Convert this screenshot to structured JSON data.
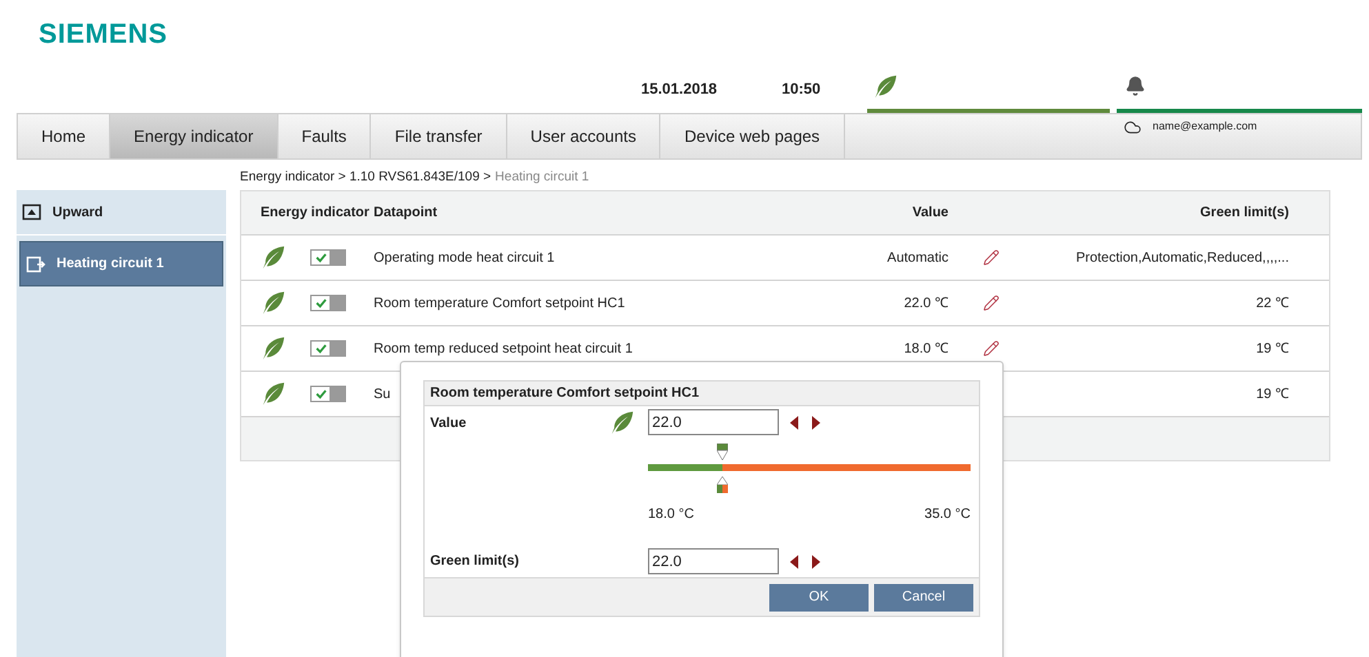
{
  "logo": "SIEMENS",
  "header": {
    "date": "15.01.2018",
    "time": "10:50",
    "user": "name@example.com"
  },
  "tabs": [
    {
      "label": "Home",
      "selected": false
    },
    {
      "label": "Energy indicator",
      "selected": true
    },
    {
      "label": "Faults",
      "selected": false
    },
    {
      "label": "File transfer",
      "selected": false
    },
    {
      "label": "User accounts",
      "selected": false
    },
    {
      "label": "Device web pages",
      "selected": false
    }
  ],
  "breadcrumb": {
    "path": "Energy indicator > 1.10 RVS61.843E/109 >",
    "current": "Heating circuit 1"
  },
  "sidebar": {
    "items": [
      {
        "label": "Upward",
        "kind": "up",
        "selected": false
      },
      {
        "label": "Heating circuit 1",
        "kind": "folder",
        "selected": true
      }
    ]
  },
  "table": {
    "columns": [
      "Energy indicator",
      "Datapoint",
      "Value",
      "Green limit(s)"
    ],
    "rows": [
      {
        "indicator_on": true,
        "datapoint": "Operating mode heat circuit 1",
        "value": "Automatic",
        "green_limits": "Protection,Automatic,Reduced,,,,..."
      },
      {
        "indicator_on": true,
        "datapoint": "Room temperature Comfort setpoint HC1",
        "value": "22.0 ℃",
        "green_limits": "22 ℃"
      },
      {
        "indicator_on": true,
        "datapoint": "Room temp reduced setpoint heat circuit 1",
        "value": "18.0 ℃",
        "green_limits": "19 ℃"
      },
      {
        "indicator_on": true,
        "datapoint": "Su",
        "green_limits": "19 ℃"
      }
    ]
  },
  "dialog": {
    "title": "Room temperature Comfort setpoint HC1",
    "value_label": "Value",
    "value": "22.0",
    "slider": {
      "level": 0.23,
      "min_label": "18.0 °C",
      "max_label": "35.0 °C"
    },
    "green_label": "Green limit(s)",
    "green_value": "22.0",
    "buttons": [
      "OK",
      "Cancel"
    ]
  }
}
